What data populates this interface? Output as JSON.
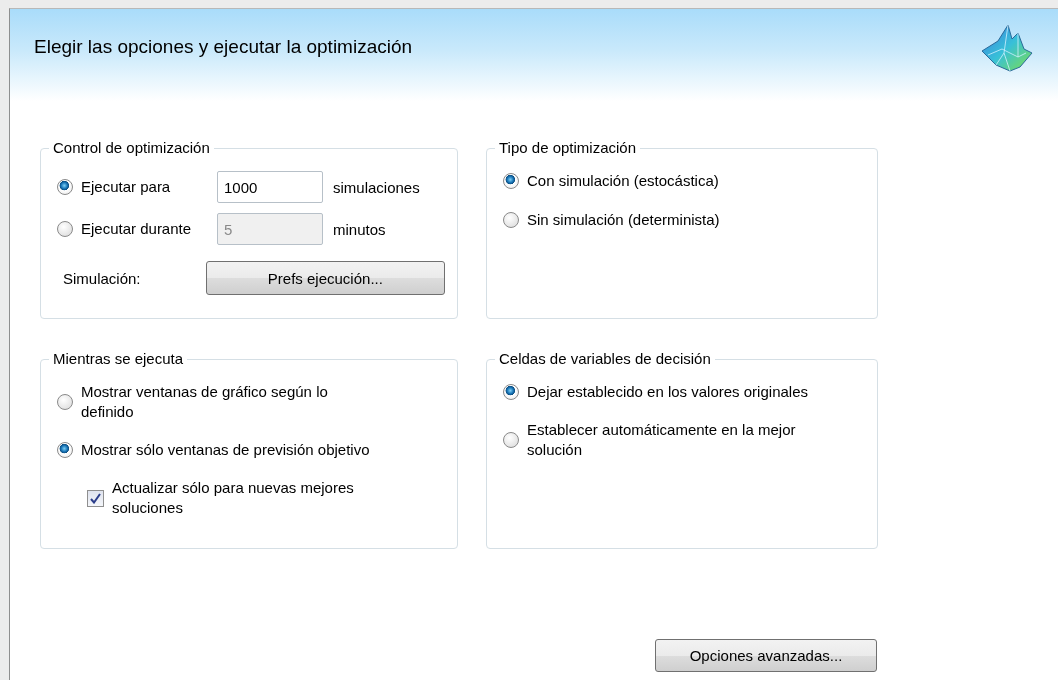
{
  "header": {
    "title": "Elegir las opciones y ejecutar la optimización"
  },
  "groups": [
    {
      "title": "Control de optimización",
      "items": [
        {
          "kind": "radio-field",
          "label": "Ejecutar para",
          "selected": true,
          "value": "1000",
          "disabled": false,
          "unit": "simulaciones"
        },
        {
          "kind": "radio-field",
          "label": "Ejecutar durante",
          "selected": false,
          "value": "5",
          "disabled": true,
          "unit": "minutos"
        },
        {
          "kind": "button-row",
          "label": "Simulación:",
          "button": "Prefs ejecución..."
        }
      ]
    },
    {
      "title": "Tipo de optimización",
      "items": [
        {
          "kind": "radio",
          "label": "Con simulación (estocástica)",
          "selected": true
        },
        {
          "kind": "radio",
          "label": "Sin simulación (determinista)",
          "selected": false
        }
      ]
    },
    {
      "title": "Mientras se ejecuta",
      "items": [
        {
          "kind": "radio",
          "label": "Mostrar ventanas de gráfico según lo definido",
          "selected": false
        },
        {
          "kind": "radio",
          "label": "Mostrar sólo ventanas de previsión objetivo",
          "selected": true
        },
        {
          "kind": "checkbox",
          "label": "Actualizar sólo para nuevas mejores soluciones",
          "checked": true
        }
      ]
    },
    {
      "title": "Celdas de variables de decisión",
      "items": [
        {
          "kind": "radio",
          "label": "Dejar establecido en los valores originales",
          "selected": true
        },
        {
          "kind": "radio",
          "label": "Establecer automáticamente en la mejor solución",
          "selected": false
        }
      ]
    }
  ],
  "footer": {
    "button": "Opciones avanzadas..."
  }
}
